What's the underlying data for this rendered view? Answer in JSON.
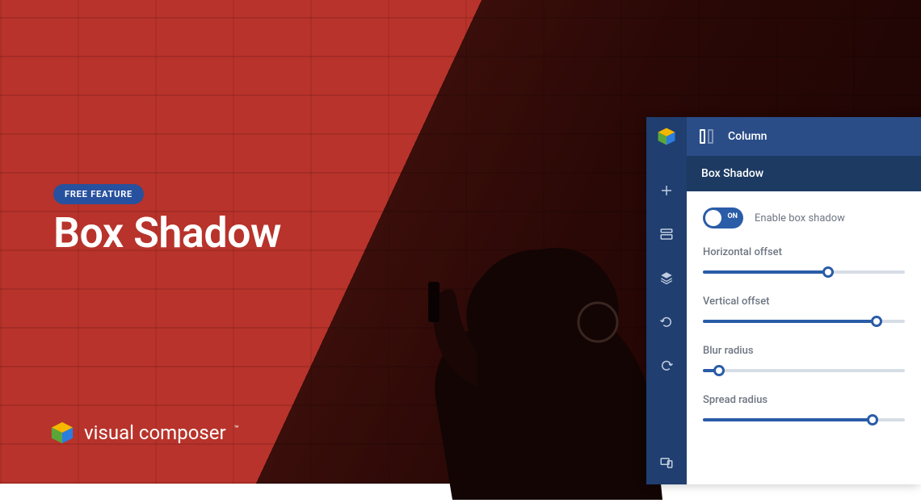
{
  "hero": {
    "badge": "FREE FEATURE",
    "title": "Box Shadow",
    "brand": "visual composer"
  },
  "panel": {
    "header_title": "Column",
    "section_title": "Box Shadow",
    "toggle": {
      "on_label": "ON",
      "text": "Enable box shadow",
      "enabled": true
    },
    "sliders": [
      {
        "label": "Horizontal offset",
        "value": 62
      },
      {
        "label": "Vertical offset",
        "value": 86
      },
      {
        "label": "Blur radius",
        "value": 8
      },
      {
        "label": "Spread radius",
        "value": 84
      }
    ]
  }
}
